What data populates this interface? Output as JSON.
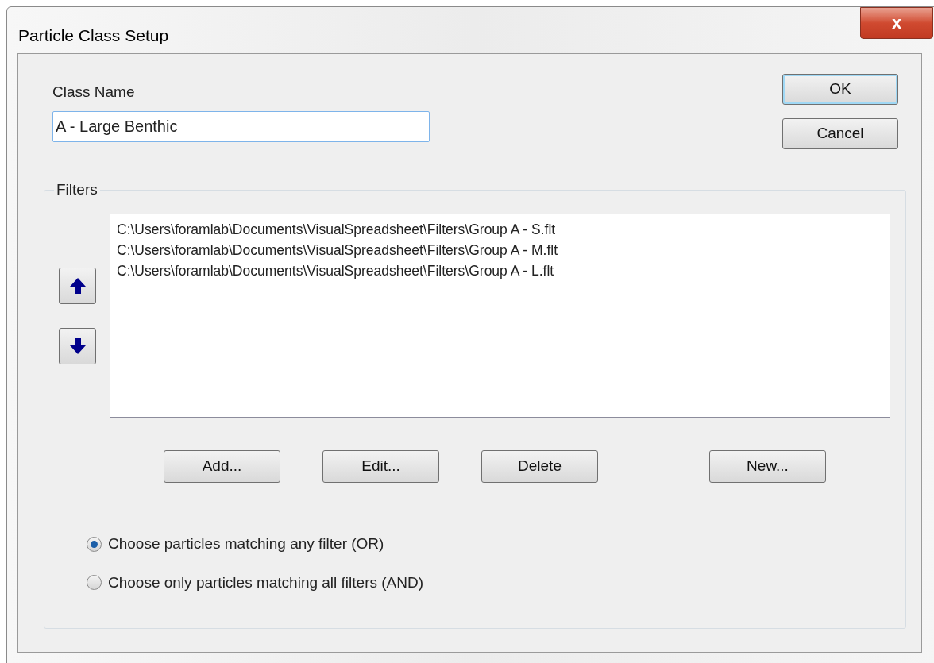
{
  "window": {
    "title": "Particle Class Setup",
    "close": "x"
  },
  "class_name": {
    "label": "Class Name",
    "value": "A - Large Benthic"
  },
  "dialog_buttons": [
    "OK",
    "Cancel"
  ],
  "filters": {
    "label": "Filters",
    "items": [
      {
        "text": "C:\\Users\\foramlab\\Documents\\VisualSpreadsheet\\Filters\\Group A - S.flt"
      },
      {
        "text": "C:\\Users\\foramlab\\Documents\\VisualSpreadsheet\\Filters\\Group A - M.flt"
      },
      {
        "text": "C:\\Users\\foramlab\\Documents\\VisualSpreadsheet\\Filters\\Group A - L.flt"
      }
    ],
    "buttons": [
      "Add...",
      "Edit...",
      "Delete",
      "New..."
    ]
  },
  "match_mode": [
    {
      "label": "Choose particles matching any filter (OR)",
      "selected": true
    },
    {
      "label": "Choose only particles matching all filters (AND)",
      "selected": false
    }
  ]
}
